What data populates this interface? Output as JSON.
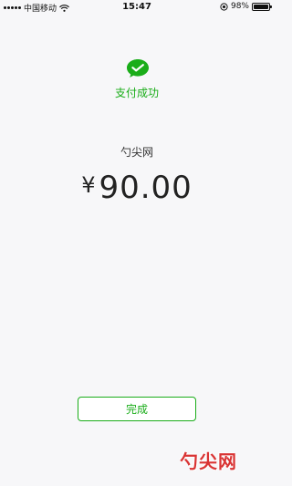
{
  "status_bar": {
    "carrier": "中国移动",
    "time": "15:47",
    "battery_percent": "98%",
    "battery_level": 0.98
  },
  "success": {
    "icon": "wechat-pay-icon",
    "label": "支付成功",
    "color": "#1aad19"
  },
  "payment": {
    "merchant": "勺尖网",
    "currency": "¥",
    "amount": "90.00"
  },
  "actions": {
    "done_label": "完成"
  },
  "watermark": {
    "text": "勺尖网",
    "color": "#d61f1f"
  }
}
